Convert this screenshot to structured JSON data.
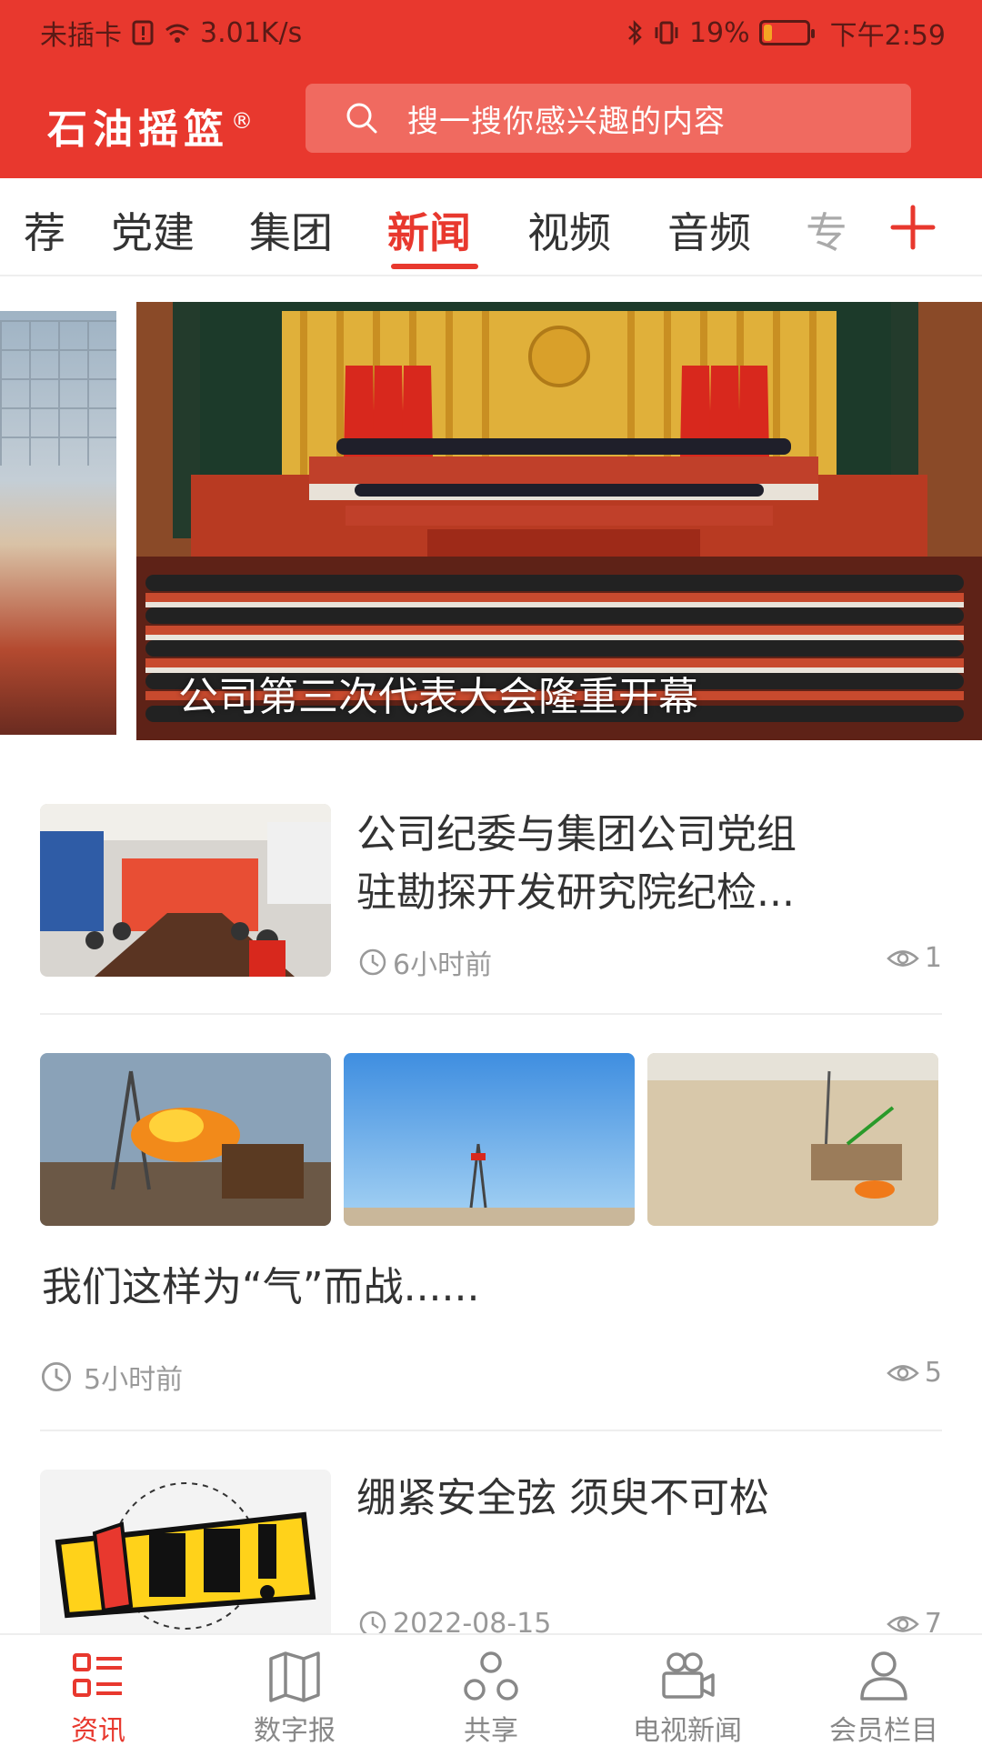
{
  "status": {
    "carrier": "未插卡",
    "speed": "3.01K/s",
    "battery": "19%",
    "time": "下午2:59"
  },
  "appbar": {
    "title": "石油摇篮",
    "trademark": "®",
    "search_placeholder": "搜一搜你感兴趣的内容"
  },
  "tabs": [
    "荐",
    "党建",
    "集团",
    "新闻",
    "视频",
    "音频",
    "专"
  ],
  "active_tab": "新闻",
  "carousel": {
    "caption": "公司第三次代表大会隆重开幕"
  },
  "news": [
    {
      "title": "公司纪委与集团公司党组驻勘探开发研究院纪检...",
      "title_line1": "公司纪委与集团公司党组",
      "title_line2": "驻勘探开发研究院纪检...",
      "time": "6小时前",
      "views": "1"
    },
    {
      "title": "我们这样为“气”而战......",
      "time": "5小时前",
      "views": "5"
    },
    {
      "title": "绷紧安全弦 须臾不可松",
      "time": "2022-08-15",
      "views": "7"
    }
  ],
  "nav": [
    {
      "label": "资讯",
      "active": true
    },
    {
      "label": "数字报",
      "active": false
    },
    {
      "label": "共享",
      "active": false
    },
    {
      "label": "电视新闻",
      "active": false
    },
    {
      "label": "会员栏目",
      "active": false
    }
  ],
  "colors": {
    "brand_red": "#e8382e",
    "text_gray": "#999999"
  },
  "icons": {
    "search": "search-icon",
    "add": "plus-icon",
    "clock": "clock-icon",
    "eye": "eye-icon"
  }
}
